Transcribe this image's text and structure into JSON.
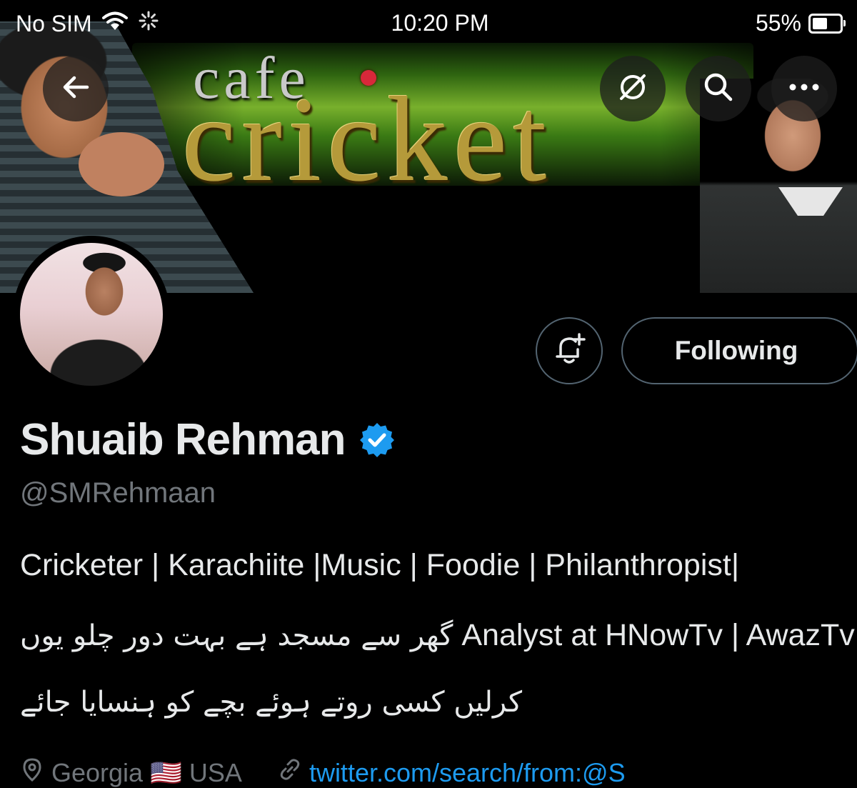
{
  "status_bar": {
    "carrier": "No SIM",
    "time": "10:20 PM",
    "battery": "55%",
    "battery_level": 0.55
  },
  "banner": {
    "line1": "cafe",
    "line2": "cricket"
  },
  "header_actions": {
    "back_icon": "arrow-left-icon",
    "translate_icon": "globe-slash-icon",
    "search_icon": "search-icon",
    "more_icon": "more-horizontal-icon"
  },
  "profile": {
    "display_name": "Shuaib Rehman",
    "handle": "@SMRehmaan",
    "bio_line1": "Cricketer | Karachiite |Music | Foodie | Philanthropist|",
    "bio_line2_en": "Analyst at HNowTv | AwazTv",
    "bio_line2_ur": "گھر سے مسجد ہے بہت دور چلو یوں",
    "bio_line3_ur": "کرلیں کسی روتے ہوئے بچے کو ہنسایا جائے",
    "location": "Georgia 🇺🇸 USA",
    "website": "twitter.com/search/from:@S"
  },
  "actions": {
    "notify_icon": "bell-plus-icon",
    "following_label": "Following"
  },
  "colors": {
    "background": "#000000",
    "text": "#e7e9ea",
    "secondary_text": "#71767b",
    "border": "#536471",
    "verified": "#1d9bf0",
    "link": "#1d9bf0"
  }
}
